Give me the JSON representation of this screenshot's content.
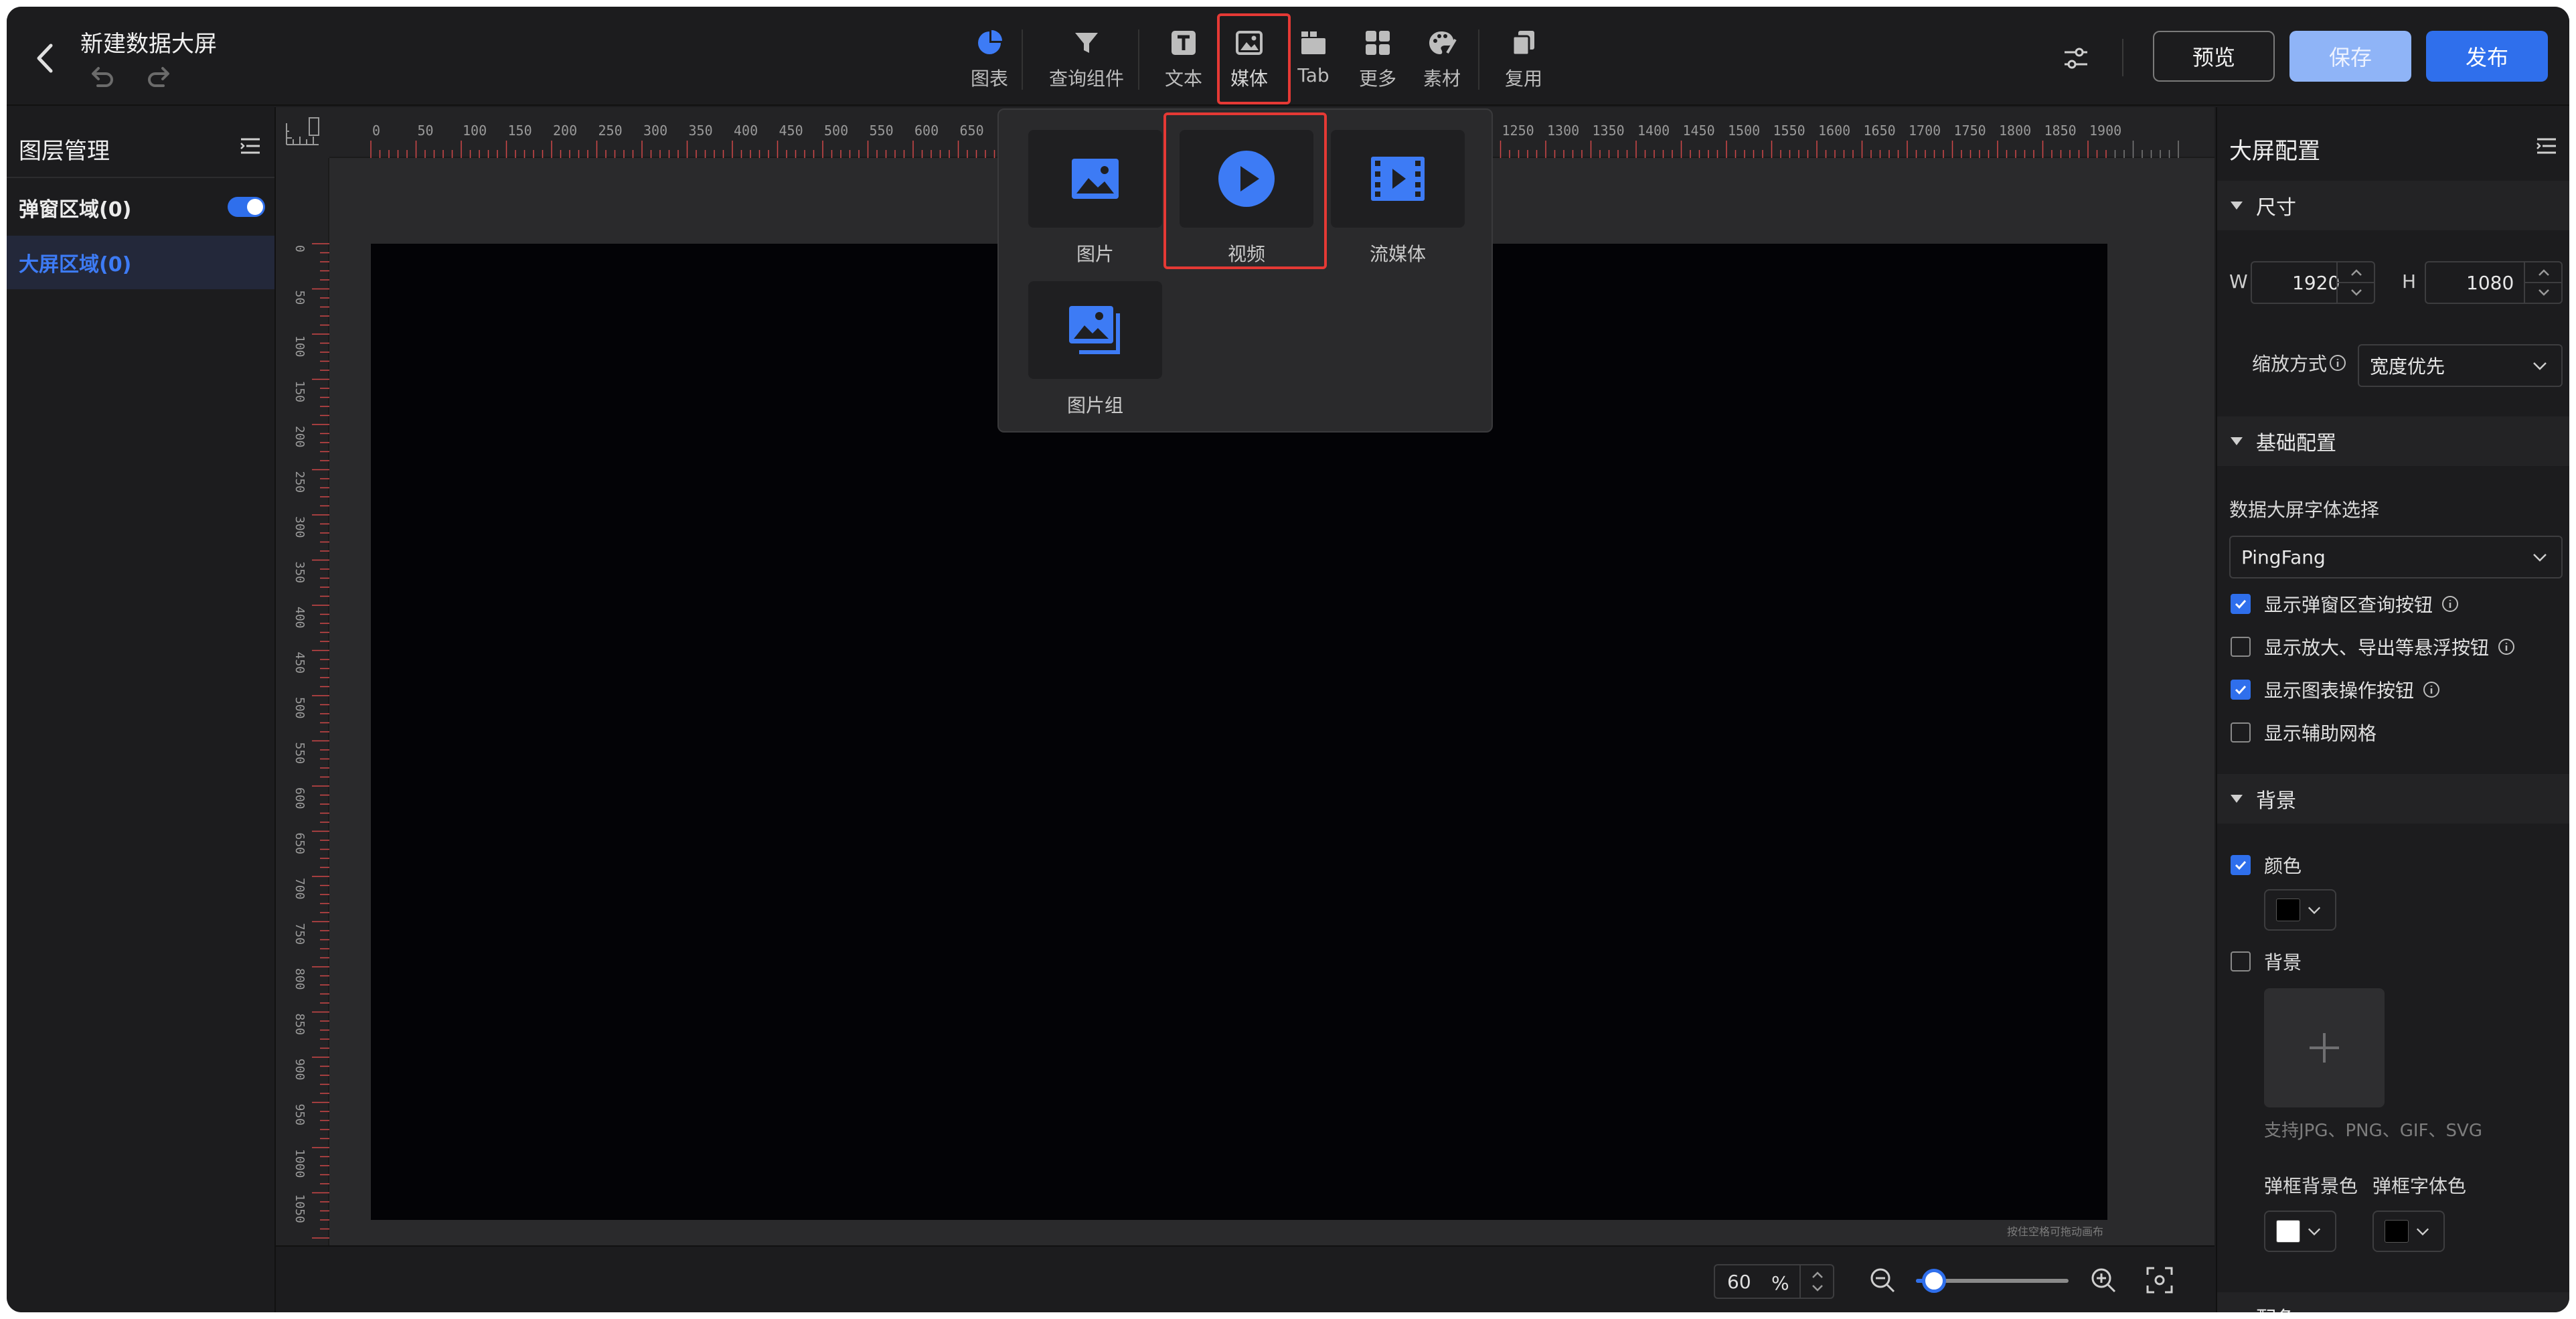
{
  "header": {
    "title": "新建数据大屏",
    "toolbar": [
      {
        "label": "图表",
        "icon": "pie-chart-icon"
      },
      {
        "label": "查询组件",
        "icon": "filter-icon"
      },
      {
        "label": "文本",
        "icon": "text-icon"
      },
      {
        "label": "媒体",
        "icon": "image-icon"
      },
      {
        "label": "Tab",
        "icon": "tab-icon"
      },
      {
        "label": "更多",
        "icon": "grid-icon"
      },
      {
        "label": "素材",
        "icon": "palette-icon"
      },
      {
        "label": "复用",
        "icon": "copy-icon"
      }
    ],
    "buttons": {
      "preview": "预览",
      "save": "保存",
      "publish": "发布"
    }
  },
  "layers": {
    "title": "图层管理",
    "popup_area": "弹窗区域(0)",
    "screen_area": "大屏区域(0)"
  },
  "media_menu": {
    "items": [
      {
        "label": "图片",
        "icon": "image-icon"
      },
      {
        "label": "视频",
        "icon": "play-icon"
      },
      {
        "label": "流媒体",
        "icon": "film-icon"
      },
      {
        "label": "图片组",
        "icon": "image-group-icon"
      }
    ],
    "selected": "视频"
  },
  "ruler": {
    "h_labels": [
      "0",
      "50",
      "100",
      "150",
      "200",
      "250",
      "300",
      "350",
      "400",
      "450",
      "500",
      "550",
      "600",
      "650",
      "1250",
      "1300",
      "1350",
      "1400",
      "1450",
      "1500",
      "1550",
      "1600",
      "1650",
      "1700",
      "1750",
      "1800",
      "1850",
      "1900"
    ],
    "v_labels": [
      "0",
      "50",
      "100",
      "150",
      "200",
      "250",
      "300",
      "350",
      "400",
      "450",
      "500",
      "550",
      "600",
      "650",
      "700",
      "750",
      "800",
      "850",
      "900",
      "950",
      "1000",
      "1050"
    ]
  },
  "canvas": {
    "hint": "按住空格可拖动画布",
    "background_color": "#030306"
  },
  "zoom": {
    "value": "60",
    "unit": "%",
    "level_fraction": 0.12
  },
  "config": {
    "title": "大屏配置",
    "size_section": "尺寸",
    "w_label": "W",
    "width": "1920",
    "h_label": "H",
    "height": "1080",
    "scale_label": "缩放方式",
    "scale_value": "宽度优先",
    "basic_section": "基础配置",
    "font_label": "数据大屏字体选择",
    "font_value": "PingFang",
    "options": [
      {
        "label": "显示弹窗区查询按钮",
        "checked": true,
        "info": true
      },
      {
        "label": "显示放大、导出等悬浮按钮",
        "checked": false,
        "info": true
      },
      {
        "label": "显示图表操作按钮",
        "checked": true,
        "info": true
      },
      {
        "label": "显示辅助网格",
        "checked": false,
        "info": false
      }
    ],
    "bg_section": "背景",
    "color_label": "颜色",
    "color_checked": true,
    "color_value": "#000000",
    "bg_label": "背景",
    "bg_checked": false,
    "upload_hint": "支持JPG、PNG、GIF、SVG",
    "popup_bg_label": "弹框背景色",
    "popup_bg_color": "#ffffff",
    "popup_font_label": "弹框字体色",
    "popup_font_color": "#000000",
    "next_section": "配色"
  },
  "colors": {
    "accent": "#2f6fec",
    "highlight": "#e53935"
  }
}
